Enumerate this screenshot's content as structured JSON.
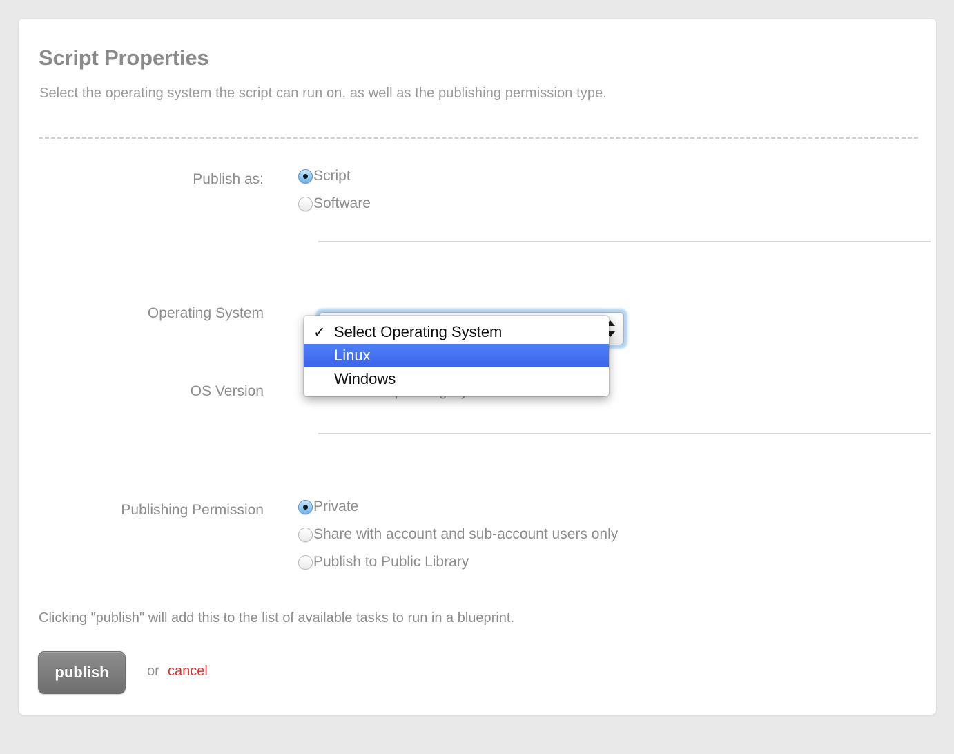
{
  "page": {
    "title": "Script Properties",
    "subtitle": "Select the operating system the script can run on, as well as the publishing permission type."
  },
  "colors": {
    "background": "#e9e9e9",
    "card": "#ffffff",
    "text_muted": "#8d8d8d",
    "heading": "#8a8a8a",
    "accent_blue": "#3a63ea",
    "radio_selected": "#9ccdf4",
    "cancel_red": "#e03030",
    "publish_button": "#7e7e7e"
  },
  "publish_as": {
    "label": "Publish as:",
    "options": [
      {
        "label": "Script",
        "selected": true
      },
      {
        "label": "Software",
        "selected": false
      }
    ]
  },
  "operating_system": {
    "label": "Operating System",
    "selected_value": "Select Operating System",
    "expanded": true,
    "options": [
      {
        "label": "Select Operating System",
        "checked": true,
        "highlighted": false
      },
      {
        "label": "Linux",
        "checked": false,
        "highlighted": true
      },
      {
        "label": "Windows",
        "checked": false,
        "highlighted": false
      }
    ],
    "check_glyph": "✓"
  },
  "os_version": {
    "label": "OS Version",
    "value": "Select an Operating System"
  },
  "publishing_permission": {
    "label": "Publishing Permission",
    "options": [
      {
        "label": "Private",
        "selected": true
      },
      {
        "label": "Share with account and sub-account users only",
        "selected": false
      },
      {
        "label": "Publish to Public Library",
        "selected": false
      }
    ]
  },
  "footer": {
    "note": "Clicking \"publish\" will add this to the list of available tasks to run in a blueprint.",
    "publish_label": "publish",
    "or_label": "or",
    "cancel_label": "cancel"
  }
}
